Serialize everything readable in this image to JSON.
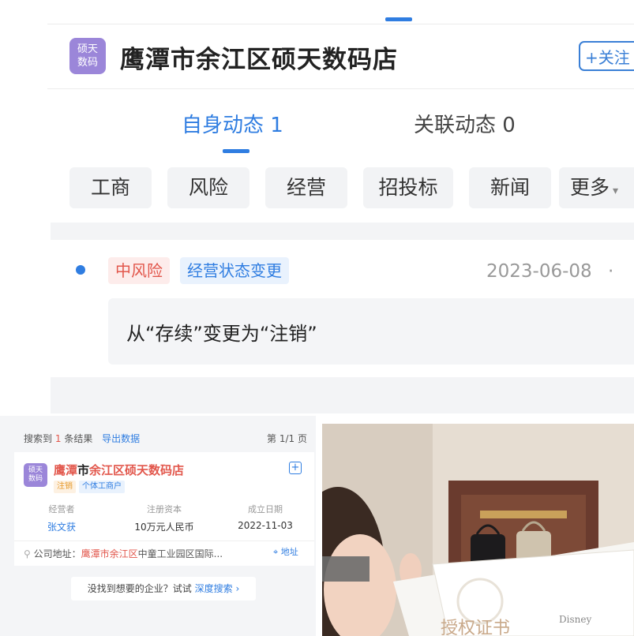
{
  "company": {
    "logo_line1": "硕天",
    "logo_line2": "数码",
    "name": "鹰潭市余江区硕天数码店",
    "follow_label": "+关注"
  },
  "tabs": [
    {
      "label": "自身动态 1",
      "active": true
    },
    {
      "label": "关联动态 0",
      "active": false
    }
  ],
  "filter_chips": [
    "工商",
    "风险",
    "经营",
    "招投标",
    "新闻",
    "更多"
  ],
  "event": {
    "risk_tag": "中风险",
    "type_tag": "经营状态变更",
    "date": "2023-06-08",
    "description": "从“存续”变更为“注销”"
  },
  "search_result": {
    "found_prefix": "搜索到",
    "found_count": "1",
    "found_suffix": "条结果",
    "export_label": "导出数据",
    "page_label": "第 1/1 页",
    "logo_line1": "硕天",
    "logo_line2": "数码",
    "name_highlight_1": "鹰潭",
    "name_mid": "市",
    "name_highlight_2": "余江区硕天数码店",
    "status_badge": "注销",
    "type_badge": "个体工商户",
    "operator_label": "经营者",
    "operator_value": "张文获",
    "capital_label": "注册资本",
    "capital_value": "10万元人民币",
    "founded_label": "成立日期",
    "founded_value": "2022-11-03",
    "address_label": "公司地址：",
    "address_highlight": "鹰潭市余江区",
    "address_rest": "中童工业园区国际...",
    "address_button": "地址",
    "not_found_text": "没找到想要的企业？试试",
    "deep_search_label": "深度搜索"
  },
  "photo": {
    "visible_text": "授权证书",
    "brand_logo": "Disney"
  },
  "colors": {
    "accent_blue": "#2f7de1",
    "risk_red": "#e2574c",
    "logo_purple": "#9b86d9"
  }
}
